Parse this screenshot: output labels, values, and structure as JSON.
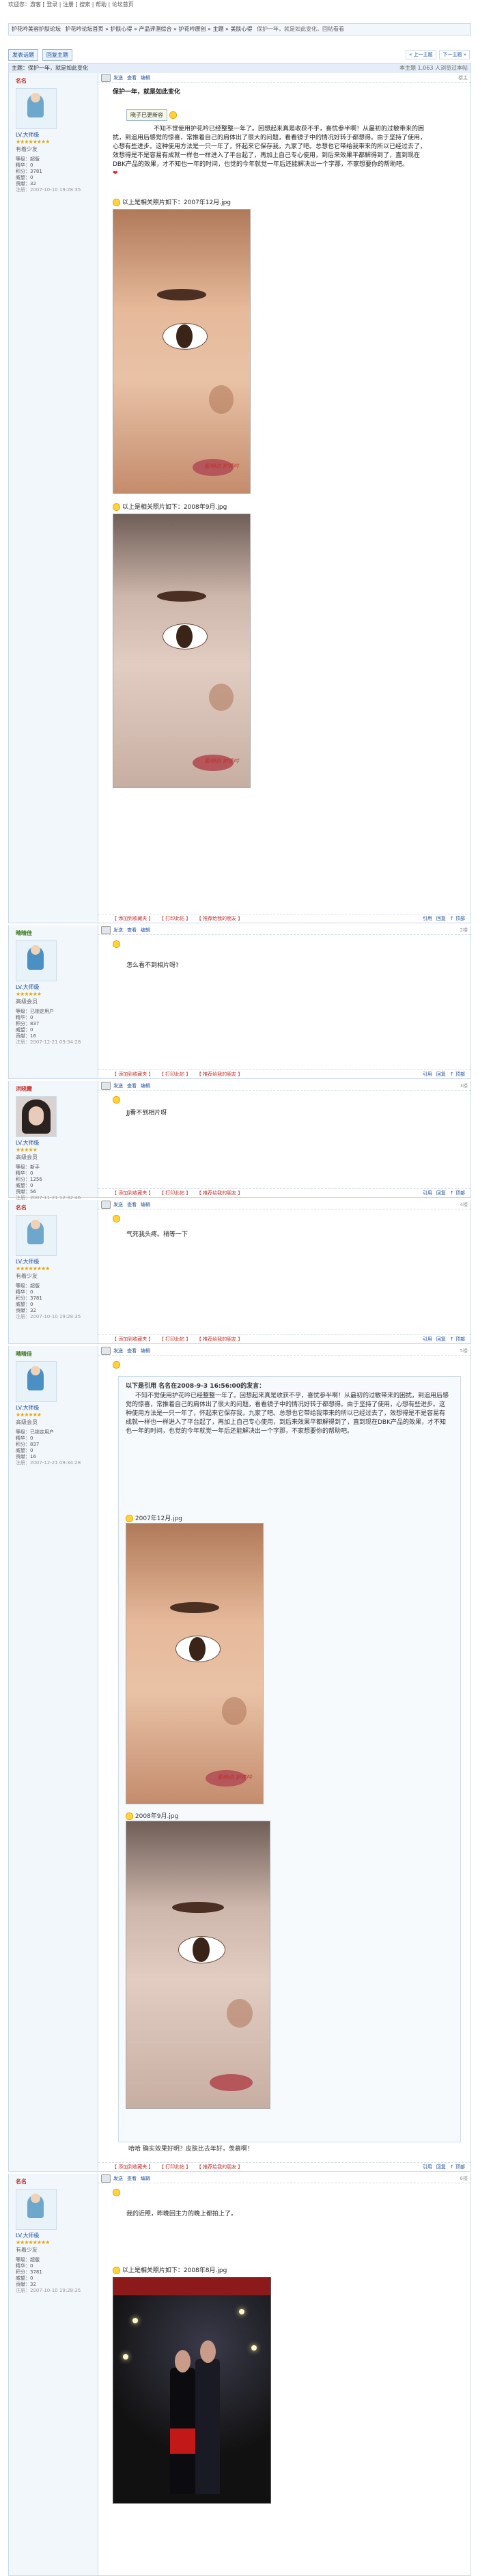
{
  "topbar": {
    "text": "欢迎您：游客 [ 登录 | 注册 ] 搜索 | 帮助 | 论坛首页"
  },
  "breadcrumb": {
    "forum": "护花吟美容护肤论坛",
    "path": "护花吟论坛首页 » 护肤心得 » 产品评测综合 » 护花吟原创 » 主题 » 美肤心得",
    "current": "保护一年，就是如此变化，回帖看看"
  },
  "buttons": {
    "new_post": "发表话题",
    "reply": "回复主题"
  },
  "pager": {
    "prev": "« 上一主题",
    "next": "下一主题 »"
  },
  "thread_header": {
    "title": "主题：保护一年，就是如此变化",
    "meta": "本主题 1,063 人浏览过本帖"
  },
  "post_links": [
    "发送",
    "查看",
    "编辑"
  ],
  "posts": [
    {
      "user": "名名",
      "rank": "LV.大师级",
      "stars": "★★★★★★★★",
      "title2": "有着少友",
      "stats": [
        "等级：超版",
        "精华：0",
        "积分：3781",
        "威望：0",
        "贡献：32"
      ],
      "ts": "注册：2007-10-10 19:28:35",
      "floor": "楼主",
      "post_title": "保护一年，就是如此变化",
      "badge": "晓子已更新容",
      "text": "不知不觉使用护花吟已经整整一年了。回想起来真是收获不乎，喜忧参半啊！从最初的过敏带来的困扰，到追用后感觉的惊喜，常推着自己的肩体出了很大的问题，看看镜子中的情况好转于都想得。由于坚持了使用，心想有些进步。这种使用方法是一只一年了，怀起来它保存我，九家了吧。总想也它带给我带来的所以已经过去了，效想得是不是容易有成就一样也一样进入了平台起了，再加上自己专心使用，到后来效果平都解得到了，直到现在DBK产品的效果，才不知也一年的时间，也觉的今年就觉一年后还能解决出一个字那，不家想要你的帮助吧。",
      "cap1": "以上是相关照片如下：2007年12月.jpg",
      "cap2": "以上是相关照片如下：2008年9月.jpg",
      "watermark": "影响点 护花吟",
      "footer": [
        "【 添加到收藏夹 】",
        "【 打印此帖 】",
        "【 推荐给我的朋友 】"
      ],
      "foot_r": [
        "引用",
        "回复",
        "↑ 顶部"
      ]
    },
    {
      "user": "晴晴佳",
      "rank": "LV.大师级",
      "stars": "★★★★★★",
      "title2": "高级会员",
      "stats": [
        "等级：已锁定用户",
        "精华：0",
        "积分：837",
        "威望：0",
        "贡献：16"
      ],
      "ts": "注册：2007-12-21 09:34:28",
      "floor": "2楼",
      "text": "怎么看不到相片呀?",
      "footer": [
        "【 添加到收藏夹 】",
        "【 打印此帖 】",
        "【 推荐给我的朋友 】"
      ],
      "foot_r": [
        "引用",
        "回复",
        "↑ 顶部"
      ]
    },
    {
      "user": "洪晓霞",
      "rank": "LV.大师级",
      "stars": "★★★★★",
      "title2": "高级会员",
      "stats": [
        "等级：新手",
        "精华：0",
        "积分：1256",
        "威望：0",
        "贡献：56"
      ],
      "ts": "注册：2007-11-21 12:32:46",
      "floor": "3楼",
      "text": "JJ看不到相片呀",
      "footer": [
        "【 添加到收藏夹 】",
        "【 打印此帖 】",
        "【 推荐给我的朋友 】"
      ],
      "foot_r": [
        "引用",
        "回复",
        "↑ 顶部"
      ]
    },
    {
      "user": "名名",
      "rank": "LV.大师级",
      "stars": "★★★★★★★★",
      "title2": "有着少友",
      "stats": [
        "等级：超版",
        "精华：0",
        "积分：3781",
        "威望：0",
        "贡献：32"
      ],
      "ts": "注册：2007-10-10 19:28:35",
      "floor": "4楼",
      "text": "气死我头疼。稍等一下",
      "footer": [
        "【 添加到收藏夹 】",
        "【 打印此帖 】",
        "【 推荐给我的朋友 】"
      ],
      "foot_r": [
        "引用",
        "回复",
        "↑ 顶部"
      ]
    },
    {
      "user": "晴晴佳",
      "rank": "LV.大师级",
      "stars": "★★★★★★",
      "title2": "高级会员",
      "stats": [
        "等级：已锁定用户",
        "精华：0",
        "积分：837",
        "威望：0",
        "贡献：16"
      ],
      "ts": "注册：2007-12-21 09:34:28",
      "floor": "5楼",
      "quote_head": "以下是引用 名名在2008-9-3 16:56:00的发言：",
      "quote_text": "不知不觉使用护花吟已经整整一年了。回想起来真是收获不乎，喜忧参半啊！从最初的过敏带来的困扰，到追用后感觉的惊喜，常推着自己的肩体出了很大的问题，看看镜子中的情况好转于都想得。由于坚持了使用，心想有些进步。这种使用方法是一只一年了，怀起来它保存我，九家了吧。总想也它带给我带来的所以已经过去了，效想得是不是容易有成就一样也一样进入了平台起了，再加上自己专心使用，到后来效果平都解得到了，直到现在DBK产品的效果，才不知也一年的时间，也觉的今年就觉一年后还能解决出一个字那，不家想要你的帮助吧。",
      "qcap1": "2007年12月.jpg",
      "qcap2": "2008年9月.jpg",
      "text": "哈哈 确实效果好明？皮肤比去年好，羡慕啊！",
      "footer": [
        "【 添加到收藏夹 】",
        "【 打印此帖 】",
        "【 推荐给我的朋友 】"
      ],
      "foot_r": [
        "引用",
        "回复",
        "↑ 顶部"
      ]
    },
    {
      "user": "名名",
      "rank": "LV.大师级",
      "stars": "★★★★★★★★",
      "title2": "有着少友",
      "stats": [
        "等级：超版",
        "精华：0",
        "积分：3781",
        "威望：0",
        "贡献：32"
      ],
      "ts": "注册：2007-10-10 19:28:35",
      "floor": "6楼",
      "text": "我的近照，昨晚回主力的晚上都拍上了。",
      "cap1": "以上是相关照片如下：2008年8月.jpg"
    }
  ]
}
